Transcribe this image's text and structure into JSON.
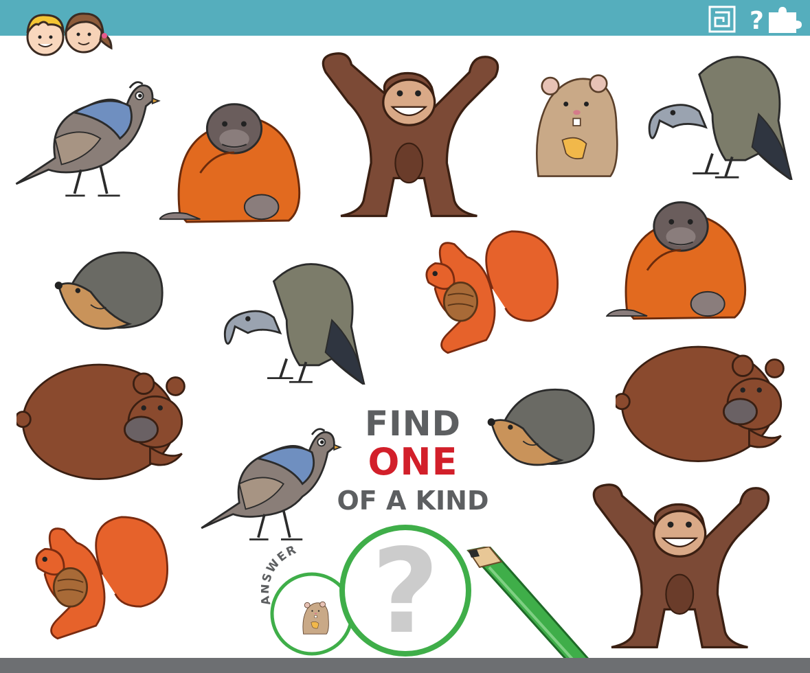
{
  "puzzle": {
    "title_line1": "FIND",
    "title_line2": "ONE",
    "title_line3": "OF A KIND",
    "answer_label": "ANSWER",
    "question_mark": "?"
  },
  "colors": {
    "topbar": "#55aebd",
    "bottombar": "#6d6f72",
    "title_gray": "#5d5f61",
    "title_red": "#d21f2a",
    "circle_green": "#3fae49"
  },
  "animals": [
    "quail",
    "orangutan",
    "chimpanzee",
    "hamster",
    "vulture",
    "hedgehog",
    "vulture",
    "squirrel",
    "orangutan",
    "bear",
    "quail",
    "hedgehog",
    "bear",
    "squirrel",
    "chimpanzee"
  ],
  "answer_animal": "hamster",
  "toolbar_icons": [
    "maze-icon",
    "question-icon",
    "puzzle-icon"
  ]
}
